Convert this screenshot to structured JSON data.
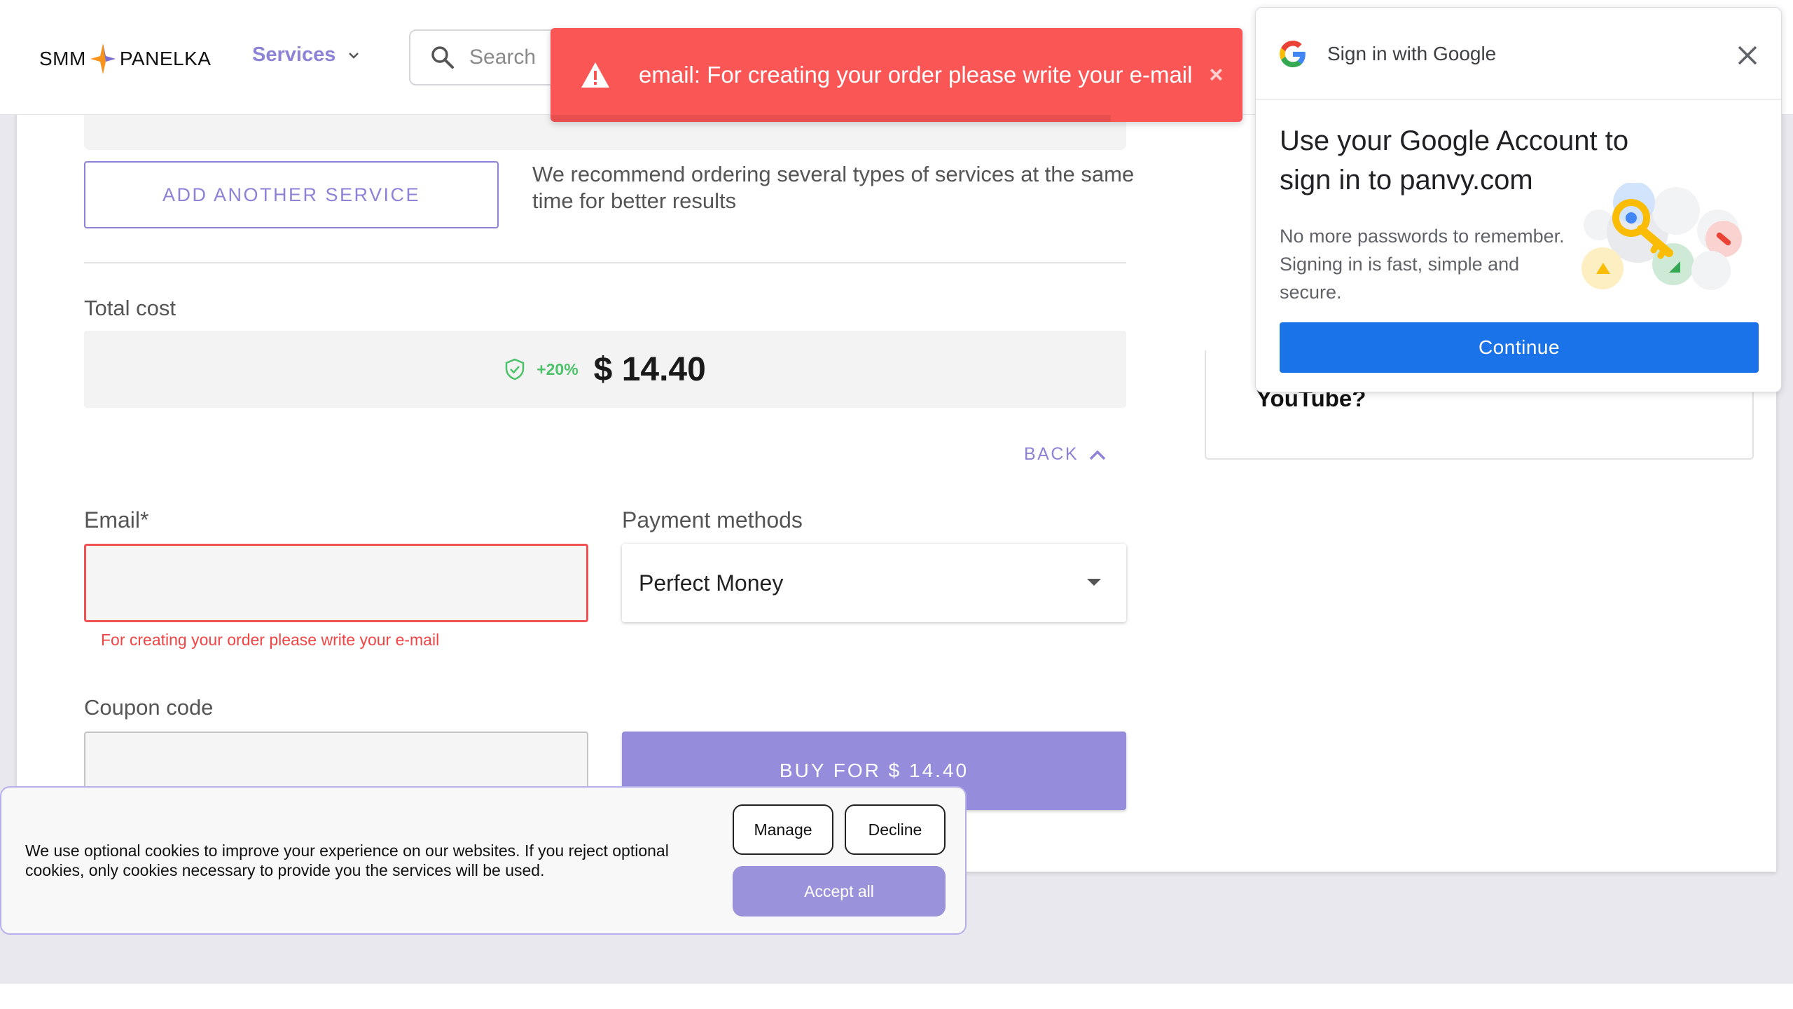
{
  "header": {
    "logo_left": "SMM",
    "logo_right": "PANELKA",
    "nav_services": "Services",
    "search_placeholder": "Search"
  },
  "toast": {
    "message": "email: For creating your order please write your e-mail",
    "close": "×",
    "progress_fraction": 0.81
  },
  "order": {
    "add_service_label": "ADD ANOTHER SERVICE",
    "recommend_text": "We recommend ordering several types of services at the same time for better results",
    "total_label": "Total cost",
    "discount": "+20%",
    "price": "$ 14.40",
    "back_label": "BACK",
    "email_label": "Email*",
    "email_value": "",
    "email_error": "For creating your order please write your e-mail",
    "payment_label": "Payment methods",
    "payment_selected": "Perfect Money",
    "coupon_label": "Coupon code",
    "coupon_value": "",
    "buy_label": "BUY FOR $ 14.40"
  },
  "side_panel": {
    "text": "YouTube?"
  },
  "google_signin": {
    "header": "Sign in with Google",
    "title": "Use your Google Account to sign in to panvy.com",
    "description": "No more passwords to remember. Signing in is fast, simple and secure.",
    "continue_label": "Continue"
  },
  "cookie_banner": {
    "text": "We use optional cookies to improve your experience on our websites. If you reject optional cookies, only cookies necessary to provide you the services will be used.",
    "manage_label": "Manage",
    "decline_label": "Decline",
    "accept_label": "Accept all"
  },
  "colors": {
    "accent": "#8c82d6",
    "error": "#fb5656",
    "success": "#4cc26a",
    "google_blue": "#1a73e8"
  }
}
